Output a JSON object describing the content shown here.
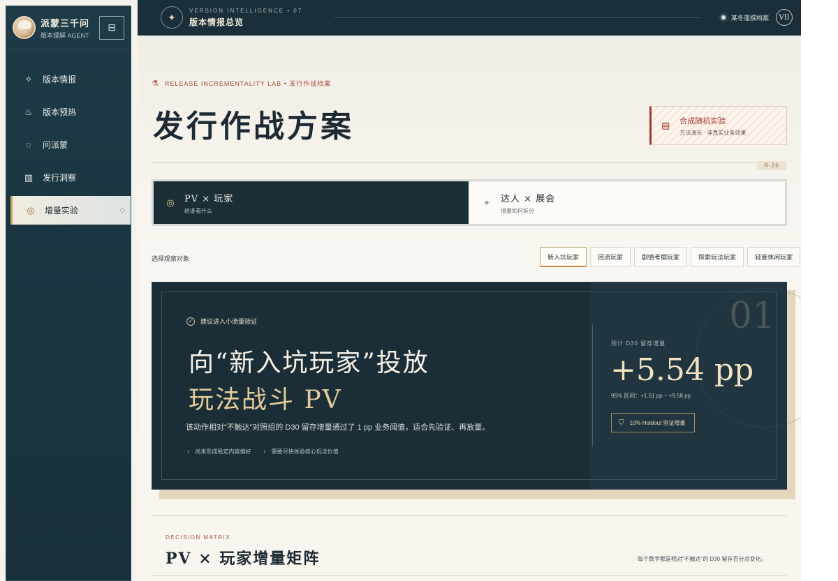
{
  "brand": {
    "title": "派蒙三千问",
    "subtitle": "版本理解 AGENT",
    "collapse_icon": "collapse-panel-icon"
  },
  "sidebar": {
    "items": [
      {
        "label": "版本情报",
        "icon": "sparkle-icon"
      },
      {
        "label": "版本预热",
        "icon": "flame-icon"
      },
      {
        "label": "问派蒙",
        "icon": "chat-bubble-icon"
      },
      {
        "label": "发行洞察",
        "icon": "bar-chart-icon"
      },
      {
        "label": "增量实验",
        "icon": "target-icon",
        "active": true
      }
    ]
  },
  "topbar": {
    "kicker": "VERSION INTELLIGENCE • 07",
    "title": "版本情报总览",
    "archive": "某冬蓬撰档案",
    "badge": "VII"
  },
  "page": {
    "kicker": "RELEASE INCREMENTALITY LAB • 发行作战档案",
    "title": "发行作战方案",
    "synthetic_title": "合成随机实验",
    "synthetic_sub": "方法演示 · 非真实业务效果",
    "ref_tag": "R-26"
  },
  "modes": [
    {
      "label": "PV × 玩家",
      "sub": "给谁看什么",
      "active": true
    },
    {
      "label": "达人 × 展会",
      "sub": "增量如何拆分",
      "active": false
    }
  ],
  "observe": {
    "label": "选择观察对象",
    "tabs": [
      "新入坑玩家",
      "回流玩家",
      "剧情考据玩家",
      "探索玩法玩家",
      "轻度休闲玩家"
    ],
    "active_index": 0
  },
  "hero": {
    "recommend": "建议进入小流量验证",
    "line1": "向“新入坑玩家”投放",
    "line2": "玩法战斗 PV",
    "desc": "该动作相对“不触达”对照组的 D30 留存增量通过了 1 pp 业务阈值，适合先验证、再放量。",
    "bullets": [
      "尚未形成稳定内容偏好",
      "需要尽快体验核心玩法价值"
    ],
    "index": "01",
    "metric_label": "预计 D30 留存增量",
    "metric_value": "+5.54 pp",
    "metric_ci": "95% 区间：+1.51 pp ~ +9.58 pp",
    "holdout": "10% Holdout 验证增量"
  },
  "matrix": {
    "kicker": "DECISION MATRIX",
    "title": "PV × 玩家增量矩阵",
    "note": "每个数字都是相对“不触达”的 D30 留存百分点变化。"
  }
}
